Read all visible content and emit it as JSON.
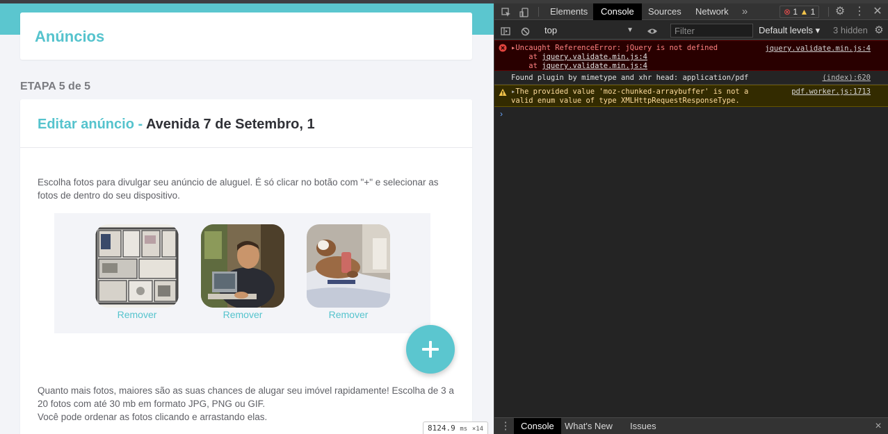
{
  "page": {
    "header_title": "Anúncios",
    "step_label": "ETAPA 5 de 5",
    "card_title_prefix": "Editar anúncio - ",
    "card_title_address": "Avenida 7 de Setembro, 1",
    "intro_text": "Escolha fotos para divulgar seu anúncio de aluguel. É só clicar no botão com \"+\" e selecionar as fotos de dentro do seu dispositivo.",
    "photos": [
      {
        "remove_label": "Remover"
      },
      {
        "remove_label": "Remover"
      },
      {
        "remove_label": "Remover"
      }
    ],
    "tips_line1": "Quanto mais fotos, maiores são as suas chances de alugar seu imóvel rapidamente! Escolha de 3 a 20 fotos com até 30 mb em formato JPG, PNG ou GIF.",
    "tips_line2": "Você pode ordenar as fotos clicando e arrastando elas.",
    "timing": {
      "value": "8124.9",
      "unit": "ms",
      "multiplier": "×14"
    },
    "colors": {
      "accent": "#5bc6cf",
      "title_dark": "#2f3036"
    }
  },
  "devtools": {
    "tabs": [
      "Elements",
      "Console",
      "Sources",
      "Network"
    ],
    "active_tab": "Console",
    "more_tabs_icon": "chevron-double-right-icon",
    "error_count": "1",
    "warning_count": "1",
    "context": "top",
    "filter_placeholder": "Filter",
    "levels_label": "Default levels ▾",
    "hidden_label": "3 hidden",
    "messages": {
      "error": {
        "line1": "Uncaught ReferenceError: jQuery is not defined",
        "at_prefix": "at ",
        "at1": "jquery.validate.min.js:4",
        "at2": "jquery.validate.min.js:4",
        "source": "jquery.validate.min.js:4"
      },
      "info": {
        "text": "Found plugin by mimetype and xhr head: application/pdf",
        "source": "(index):620"
      },
      "warning": {
        "line1": "The provided value 'moz-chunked-arraybuffer' is not a",
        "line2": "valid enum value of type XMLHttpRequestResponseType.",
        "source": "pdf.worker.js:1713"
      }
    },
    "prompt_symbol": "›",
    "drawer_tabs": [
      "Console",
      "What's New",
      "Issues"
    ],
    "drawer_close": "×"
  }
}
